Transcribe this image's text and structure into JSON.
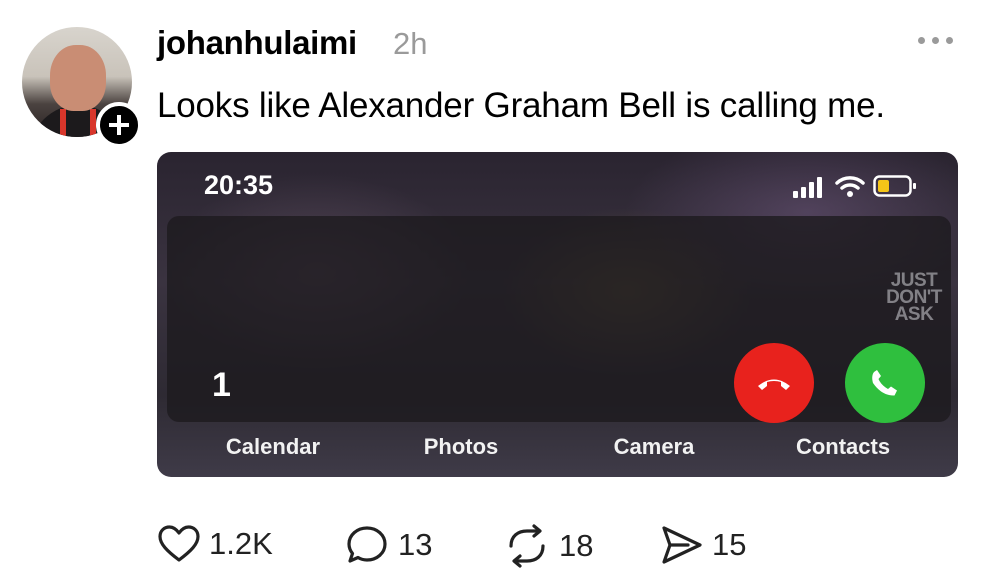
{
  "post": {
    "username": "johanhulaimi",
    "time": "2h",
    "text": "Looks like Alexander Graham Bell is calling me."
  },
  "follow_badge": "+",
  "media": {
    "status_time": "20:35",
    "watermark": [
      "JUST",
      "DON'T",
      "ASK"
    ],
    "caller": "1",
    "dock": [
      "Calendar",
      "Photos",
      "Camera",
      "Contacts"
    ],
    "colors": {
      "decline": "#e8221d",
      "accept": "#2fbf3e",
      "battery": "#f5c518"
    }
  },
  "actions": {
    "likes": "1.2K",
    "replies": "13",
    "reposts": "18",
    "shares": "15"
  },
  "icons": [
    "more-icon",
    "heart-icon",
    "comment-icon",
    "repost-icon",
    "share-icon",
    "phone-decline-icon",
    "phone-accept-icon",
    "signal-icon",
    "wifi-icon",
    "battery-icon"
  ]
}
